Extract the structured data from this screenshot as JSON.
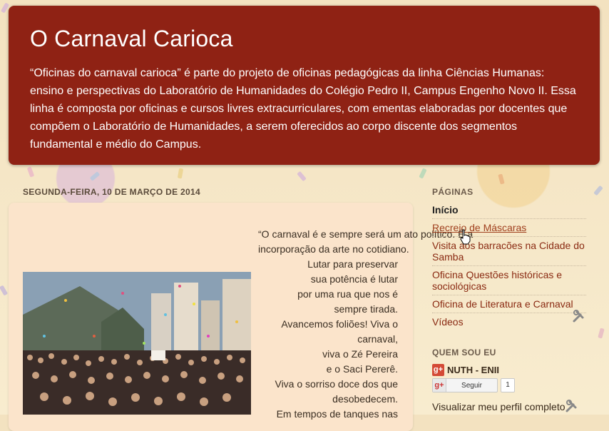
{
  "blog": {
    "title": "O Carnaval Carioca",
    "description": "“Oficinas do carnaval carioca” é parte do projeto de oficinas pedagógicas da linha Ciências Humanas: ensino e perspectivas do Laboratório de Humanidades do Colégio Pedro II, Campus Engenho Novo II. Essa linha é composta por oficinas e cursos livres extracurriculares, com ementas elaboradas por docentes que compõem o Laboratório de Humanidades, a serem oferecidos ao corpo discente dos segmentos fundamental e médio do Campus."
  },
  "post": {
    "date": "SEGUNDA-FEIRA, 10 DE MARÇO DE 2014",
    "poem_lines": [
      "“O carnaval é e sempre será um ato político. É a",
      "incorporação da arte no cotidiano.",
      "Lutar para preservar",
      "sua potência é lutar",
      "por uma rua que nos é",
      "sempre tirada.",
      "Avancemos foliões! Viva o",
      "carnaval,",
      "viva o Zé Pereira",
      "e o Saci Pererê.",
      "Viva o sorriso doce dos que",
      "desobedecem.",
      "Em tempos de tanques nas"
    ]
  },
  "sidebar": {
    "pages_title": "PÁGINAS",
    "pages": [
      "Início",
      "Recreio de Máscaras",
      "Visita aos barracões na Cidade do Samba",
      "Oficina Questões históricas e sociológicas",
      "Oficina de Literatura e Carnaval",
      "Vídeos"
    ],
    "about_title": "QUEM SOU EU",
    "profile_name": "NUTH - ENII",
    "gplus_glyph": "g+",
    "follow_label": "Seguir",
    "follow_count": "1",
    "view_profile": "Visualizar meu perfil completo"
  },
  "colors": {
    "header_bg": "#8f2214",
    "post_bg": "#fbe4cb",
    "link": "#8a2a12",
    "page_bg": "#f6e8c8"
  }
}
